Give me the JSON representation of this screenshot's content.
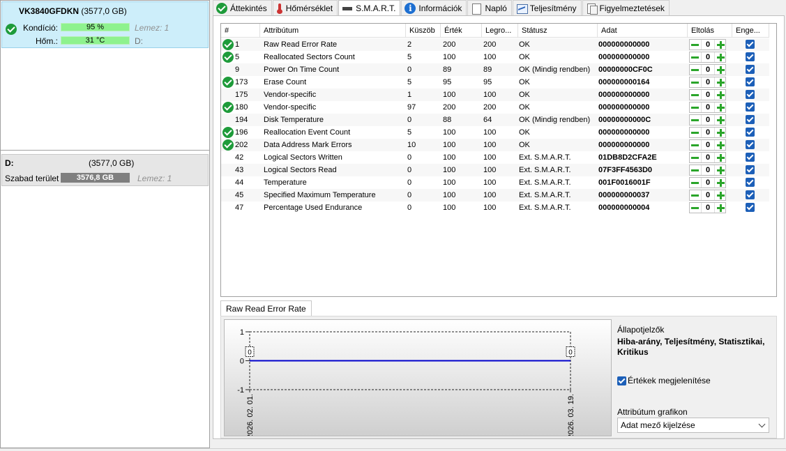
{
  "disk": {
    "name": "VK3840GFDKN",
    "size": "(3577,0 GB)",
    "condition_label": "Kondíció:",
    "condition_value": "95 %",
    "condition_fraction": 0.95,
    "condition_note": "Lemez: 1",
    "temp_label": "Hőm.:",
    "temp_value": "31 °C",
    "temp_note": "D:"
  },
  "volume": {
    "label": "D:",
    "size": "(3577,0 GB)",
    "free_label": "Szabad terület",
    "free_value": "3576,8 GB",
    "note": "Lemez: 1"
  },
  "tabs": [
    {
      "label": "Áttekintés",
      "icon": "check-icon"
    },
    {
      "label": "Hőmérséklet",
      "icon": "thermometer-icon"
    },
    {
      "label": "S.M.A.R.T.",
      "icon": "smart-icon"
    },
    {
      "label": "Információk",
      "icon": "info-icon"
    },
    {
      "label": "Napló",
      "icon": "document-icon"
    },
    {
      "label": "Teljesítmény",
      "icon": "chart-icon"
    },
    {
      "label": "Figyelmeztetések",
      "icon": "warnings-icon"
    }
  ],
  "table": {
    "headers": [
      "#",
      "Attribútum",
      "Küszöb",
      "Érték",
      "Legro...",
      "Státusz",
      "Adat",
      "Eltolás",
      "Enge..."
    ],
    "rows": [
      {
        "id": "1",
        "name": "Raw Read Error Rate",
        "threshold": "2",
        "value": "200",
        "worst": "200",
        "status": "OK",
        "data": "000000000000",
        "offset": "0",
        "ok": true
      },
      {
        "id": "5",
        "name": "Reallocated Sectors Count",
        "threshold": "5",
        "value": "100",
        "worst": "100",
        "status": "OK",
        "data": "000000000000",
        "offset": "0",
        "ok": true
      },
      {
        "id": "9",
        "name": "Power On Time Count",
        "threshold": "0",
        "value": "89",
        "worst": "89",
        "status": "OK (Mindig rendben)",
        "data": "00000000CF0C",
        "offset": "0",
        "ok": false
      },
      {
        "id": "173",
        "name": "Erase Count",
        "threshold": "5",
        "value": "95",
        "worst": "95",
        "status": "OK",
        "data": "000000000164",
        "offset": "0",
        "ok": true
      },
      {
        "id": "175",
        "name": "Vendor-specific",
        "threshold": "1",
        "value": "100",
        "worst": "100",
        "status": "OK",
        "data": "000000000000",
        "offset": "0",
        "ok": false
      },
      {
        "id": "180",
        "name": "Vendor-specific",
        "threshold": "97",
        "value": "200",
        "worst": "200",
        "status": "OK",
        "data": "000000000000",
        "offset": "0",
        "ok": true
      },
      {
        "id": "194",
        "name": "Disk Temperature",
        "threshold": "0",
        "value": "88",
        "worst": "64",
        "status": "OK (Mindig rendben)",
        "data": "00000000000C",
        "offset": "0",
        "ok": false
      },
      {
        "id": "196",
        "name": "Reallocation Event Count",
        "threshold": "5",
        "value": "100",
        "worst": "100",
        "status": "OK",
        "data": "000000000000",
        "offset": "0",
        "ok": true
      },
      {
        "id": "202",
        "name": "Data Address Mark Errors",
        "threshold": "10",
        "value": "100",
        "worst": "100",
        "status": "OK",
        "data": "000000000000",
        "offset": "0",
        "ok": true
      },
      {
        "id": "42",
        "name": "Logical Sectors Written",
        "threshold": "0",
        "value": "100",
        "worst": "100",
        "status": "Ext. S.M.A.R.T.",
        "data": "01DB8D2CFA2E",
        "offset": "0",
        "ok": false
      },
      {
        "id": "43",
        "name": "Logical Sectors Read",
        "threshold": "0",
        "value": "100",
        "worst": "100",
        "status": "Ext. S.M.A.R.T.",
        "data": "07F3FF4563D0",
        "offset": "0",
        "ok": false
      },
      {
        "id": "44",
        "name": "Temperature",
        "threshold": "0",
        "value": "100",
        "worst": "100",
        "status": "Ext. S.M.A.R.T.",
        "data": "001F0016001F",
        "offset": "0",
        "ok": false
      },
      {
        "id": "45",
        "name": "Specified Maximum Temperature",
        "threshold": "0",
        "value": "100",
        "worst": "100",
        "status": "Ext. S.M.A.R.T.",
        "data": "000000000037",
        "offset": "0",
        "ok": false
      },
      {
        "id": "47",
        "name": "Percentage Used Endurance",
        "threshold": "0",
        "value": "100",
        "worst": "100",
        "status": "Ext. S.M.A.R.T.",
        "data": "000000000004",
        "offset": "0",
        "ok": false
      }
    ]
  },
  "graph": {
    "tab_label": "Raw Read Error Rate",
    "status_title": "Állapotjelzők",
    "status_values": "Hiba-arány, Teljesítmény, Statisztikai, Kritikus",
    "show_values_label": "Értékek megjelenítése",
    "attr_graph_label": "Attribútum grafikon",
    "attr_graph_selected": "Adat mező kijelzése"
  },
  "chart_data": {
    "type": "line",
    "x": [
      "2026. 02. 01.",
      "2026. 03. 19."
    ],
    "series": [
      {
        "values": [
          0,
          0
        ]
      }
    ],
    "point_labels": [
      "0",
      "0"
    ],
    "yticks": [
      "1",
      "0",
      "-1"
    ],
    "ylim": [
      -1,
      1
    ],
    "line_color": "#0000cc"
  }
}
